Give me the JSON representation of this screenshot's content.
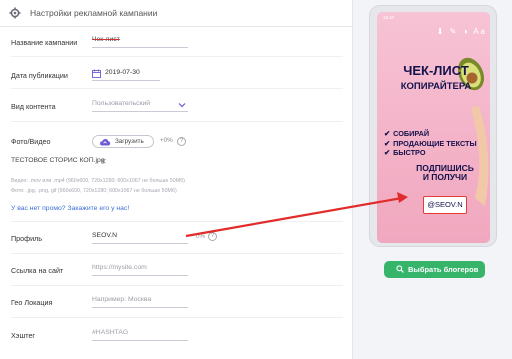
{
  "header": {
    "title": "Настройки рекламной кампании"
  },
  "form": {
    "campaign_name": {
      "label": "Название кампании",
      "value": "Чек-лист"
    },
    "publish_date": {
      "label": "Дата публикации",
      "value": "2019-07-30"
    },
    "content_type": {
      "label": "Вид контента",
      "value": "Пользовательский"
    },
    "media": {
      "label": "Фото/Видео",
      "upload_label": "Загрузить",
      "count": "+0%",
      "help": "?",
      "filename": "ТЕСТОВОЕ СТОРИС КОП.jpg",
      "hint_video": "Видео: .mov или .mp4 (960х600, 720х1280; 600х1067 не больше 50Мб)",
      "hint_photo": "Фото: .jpg, .png, gif (960х600, 720х1280; 600х1067 не больше 50Мб)",
      "promo_link": "У вас нет промо? Закажите его у нас!"
    },
    "profile": {
      "label": "Профиль",
      "value": "SEOV.N",
      "percent": "0%"
    },
    "site": {
      "label": "Ссылка на сайт",
      "placeholder": "https://mysite.com"
    },
    "geo": {
      "label": "Гео Локация",
      "placeholder": "Например: Москва"
    },
    "hashtag": {
      "label": "Хэштег",
      "placeholder": "#HASHTAG"
    }
  },
  "preview": {
    "topbar": "18:47",
    "tools": "⬇ ✎ ◑ Aa",
    "title": "ЧЕК-ЛИСТ",
    "subtitle": "КОПИРАЙТЕРА",
    "bullets": [
      "СОБИРАЙ",
      "ПРОДАЮЩИЕ ТЕКСТЫ",
      "БЫСТРО"
    ],
    "subscribe_line1": "ПОДПИШИСЬ",
    "subscribe_line2": "И ПОЛУЧИ",
    "handle": "@SEOV.N"
  },
  "actions": {
    "choose_bloggers": "Выбрать блогеров"
  },
  "colors": {
    "accent_green": "#35b46a",
    "link_blue": "#3d6fd6",
    "upload_purple": "#6b5bd6",
    "arrow_red": "#e22b2b"
  }
}
